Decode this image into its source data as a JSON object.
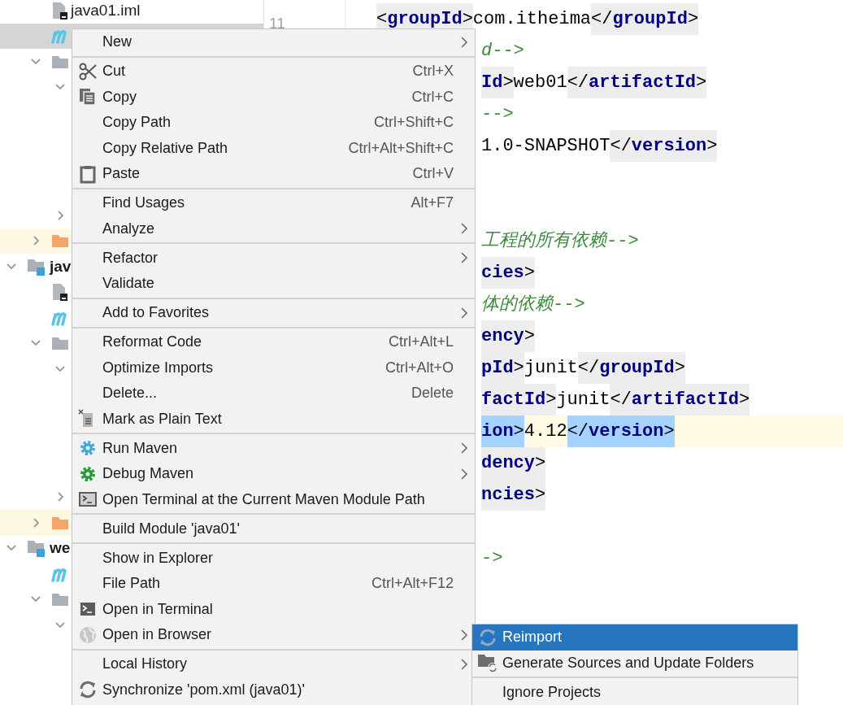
{
  "project_tree": {
    "items": [
      {
        "label": "java01.iml",
        "kind": "iml-file",
        "selected": false
      },
      {
        "kind": "maven-file",
        "selected": true
      },
      {
        "kind": "folder",
        "expanded": true,
        "selected": false,
        "children": [
          {
            "expanded": true,
            "selected": false
          },
          {
            "expanded": false,
            "selected": false
          }
        ]
      },
      {
        "kind": "excluded-folder",
        "expanded": false,
        "selected": false
      },
      {
        "label": "jav",
        "kind": "module",
        "expanded": true,
        "selected": false,
        "children": [
          {
            "kind": "iml-file",
            "selected": false
          },
          {
            "kind": "maven-file",
            "selected": false
          },
          {
            "kind": "folder",
            "expanded": true,
            "selected": false,
            "children": [
              {
                "expanded": true,
                "selected": false
              },
              {
                "expanded": false,
                "selected": false
              }
            ]
          },
          {
            "kind": "excluded-folder",
            "expanded": false,
            "selected": false
          }
        ]
      },
      {
        "label": "we",
        "kind": "module",
        "expanded": true,
        "selected": false,
        "children": [
          {
            "kind": "maven-file",
            "selected": false
          },
          {
            "kind": "folder",
            "expanded": true,
            "selected": false,
            "children": [
              {
                "expanded": true,
                "selected": false
              }
            ]
          }
        ]
      }
    ]
  },
  "gutter": {
    "line_number": "11"
  },
  "editor": {
    "lines": [
      {
        "kind": "full",
        "current": false,
        "groups": [
          {
            "kind": "match",
            "tokens": [
              {
                "kind": "p",
                "text": "<"
              },
              {
                "kind": "t",
                "text": "groupId"
              },
              {
                "kind": "p",
                "text": ">"
              }
            ]
          },
          {
            "kind": "plain",
            "tokens": [
              {
                "kind": "x",
                "text": "com.itheima"
              }
            ]
          },
          {
            "kind": "match",
            "tokens": [
              {
                "kind": "p",
                "text": "</"
              },
              {
                "kind": "t",
                "text": "groupId"
              },
              {
                "kind": "p",
                "text": ">"
              }
            ]
          }
        ]
      },
      {
        "kind": "clipped",
        "current": false,
        "groups": [
          {
            "kind": "plain",
            "tokens": [
              {
                "kind": "c",
                "text": "d-->"
              }
            ]
          }
        ]
      },
      {
        "kind": "clipped",
        "current": false,
        "groups": [
          {
            "kind": "match",
            "tokens": [
              {
                "kind": "t",
                "text": "Id"
              },
              {
                "kind": "p",
                "text": ">"
              }
            ]
          },
          {
            "kind": "plain",
            "tokens": [
              {
                "kind": "x",
                "text": "web01"
              }
            ]
          },
          {
            "kind": "match",
            "tokens": [
              {
                "kind": "p",
                "text": "</"
              },
              {
                "kind": "t",
                "text": "artifactId"
              },
              {
                "kind": "p",
                "text": ">"
              }
            ]
          }
        ]
      },
      {
        "kind": "clipped",
        "current": false,
        "groups": [
          {
            "kind": "plain",
            "tokens": [
              {
                "kind": "c",
                "text": "-->"
              }
            ]
          }
        ]
      },
      {
        "kind": "clipped",
        "current": false,
        "groups": [
          {
            "kind": "plain",
            "tokens": [
              {
                "kind": "x",
                "text": "1.0-SNAPSHOT"
              }
            ]
          },
          {
            "kind": "match",
            "tokens": [
              {
                "kind": "p",
                "text": "</"
              },
              {
                "kind": "t",
                "text": "version"
              },
              {
                "kind": "p",
                "text": ">"
              }
            ]
          }
        ]
      },
      {
        "kind": "blank"
      },
      {
        "kind": "blank"
      },
      {
        "kind": "clipped",
        "current": false,
        "groups": [
          {
            "kind": "plain",
            "tokens": [
              {
                "kind": "c",
                "text": "工程的所有依赖-->"
              }
            ]
          }
        ]
      },
      {
        "kind": "clipped",
        "current": false,
        "groups": [
          {
            "kind": "match",
            "tokens": [
              {
                "kind": "t",
                "text": "cies"
              },
              {
                "kind": "p",
                "text": ">"
              }
            ]
          }
        ]
      },
      {
        "kind": "clipped",
        "current": false,
        "groups": [
          {
            "kind": "plain",
            "tokens": [
              {
                "kind": "c",
                "text": "体的依赖-->"
              }
            ]
          }
        ]
      },
      {
        "kind": "clipped",
        "current": false,
        "groups": [
          {
            "kind": "match",
            "tokens": [
              {
                "kind": "t",
                "text": "ency"
              },
              {
                "kind": "p",
                "text": ">"
              }
            ]
          }
        ]
      },
      {
        "kind": "clipped",
        "current": false,
        "groups": [
          {
            "kind": "match",
            "tokens": [
              {
                "kind": "t",
                "text": "pId"
              },
              {
                "kind": "p",
                "text": ">"
              }
            ]
          },
          {
            "kind": "plain",
            "tokens": [
              {
                "kind": "x",
                "text": "junit"
              }
            ]
          },
          {
            "kind": "match",
            "tokens": [
              {
                "kind": "p",
                "text": "</"
              },
              {
                "kind": "t",
                "text": "groupId"
              },
              {
                "kind": "p",
                "text": ">"
              }
            ]
          }
        ]
      },
      {
        "kind": "clipped",
        "current": false,
        "groups": [
          {
            "kind": "match",
            "tokens": [
              {
                "kind": "t",
                "text": "factId"
              },
              {
                "kind": "p",
                "text": ">"
              }
            ]
          },
          {
            "kind": "plain",
            "tokens": [
              {
                "kind": "x",
                "text": "junit"
              }
            ]
          },
          {
            "kind": "match",
            "tokens": [
              {
                "kind": "p",
                "text": "</"
              },
              {
                "kind": "t",
                "text": "artifactId"
              },
              {
                "kind": "p",
                "text": ">"
              }
            ]
          }
        ]
      },
      {
        "kind": "clipped",
        "current": true,
        "groups": [
          {
            "kind": "selection",
            "tokens": [
              {
                "kind": "t",
                "text": "ion"
              },
              {
                "kind": "p",
                "text": ">"
              }
            ]
          },
          {
            "kind": "plain",
            "tokens": [
              {
                "kind": "x",
                "text": "4.12"
              }
            ]
          },
          {
            "kind": "selection",
            "tokens": [
              {
                "kind": "p",
                "text": "</"
              },
              {
                "kind": "t",
                "text": "version"
              },
              {
                "kind": "p",
                "text": ">"
              }
            ]
          }
        ]
      },
      {
        "kind": "clipped",
        "current": false,
        "groups": [
          {
            "kind": "match",
            "tokens": [
              {
                "kind": "t",
                "text": "dency"
              },
              {
                "kind": "p",
                "text": ">"
              }
            ]
          }
        ]
      },
      {
        "kind": "clipped",
        "current": false,
        "groups": [
          {
            "kind": "match",
            "tokens": [
              {
                "kind": "t",
                "text": "ncies"
              },
              {
                "kind": "p",
                "text": ">"
              }
            ]
          }
        ]
      },
      {
        "kind": "blank"
      },
      {
        "kind": "clipped",
        "current": false,
        "groups": [
          {
            "kind": "plain",
            "tokens": [
              {
                "kind": "c",
                "text": "->"
              }
            ]
          }
        ]
      }
    ]
  },
  "context_menu": {
    "groups": [
      [
        {
          "label": "New",
          "kind": "plain",
          "has_submenu": true
        }
      ],
      [
        {
          "label": "Cut",
          "shortcut": "Ctrl+X",
          "kind": "cut",
          "has_submenu": false
        },
        {
          "label": "Copy",
          "shortcut": "Ctrl+C",
          "kind": "copy",
          "has_submenu": false
        },
        {
          "label": "Copy Path",
          "shortcut": "Ctrl+Shift+C",
          "kind": "plain",
          "has_submenu": false
        },
        {
          "label": "Copy Relative Path",
          "shortcut": "Ctrl+Alt+Shift+C",
          "kind": "plain",
          "has_submenu": false
        },
        {
          "label": "Paste",
          "shortcut": "Ctrl+V",
          "kind": "paste",
          "has_submenu": false
        }
      ],
      [
        {
          "label": "Find Usages",
          "shortcut": "Alt+F7",
          "kind": "plain",
          "has_submenu": false
        },
        {
          "label": "Analyze",
          "kind": "plain",
          "has_submenu": true
        }
      ],
      [
        {
          "label": "Refactor",
          "kind": "plain",
          "has_submenu": true
        },
        {
          "label": "Validate",
          "kind": "plain",
          "has_submenu": false
        }
      ],
      [
        {
          "label": "Add to Favorites",
          "kind": "plain",
          "has_submenu": true
        }
      ],
      [
        {
          "label": "Reformat Code",
          "shortcut": "Ctrl+Alt+L",
          "kind": "plain",
          "has_submenu": false
        },
        {
          "label": "Optimize Imports",
          "shortcut": "Ctrl+Alt+O",
          "kind": "plain",
          "has_submenu": false
        },
        {
          "label": "Delete...",
          "shortcut": "Delete",
          "kind": "plain",
          "has_submenu": false
        },
        {
          "label": "Mark as Plain Text",
          "kind": "mark-plain",
          "has_submenu": false
        }
      ],
      [
        {
          "label": "Run Maven",
          "kind": "run",
          "has_submenu": true
        },
        {
          "label": "Debug Maven",
          "kind": "debug",
          "has_submenu": true
        },
        {
          "label": "Open Terminal at the Current Maven Module Path",
          "kind": "terminal-outline",
          "has_submenu": false
        }
      ],
      [
        {
          "label": "Build Module 'java01'",
          "kind": "plain",
          "has_submenu": false
        }
      ],
      [
        {
          "label": "Show in Explorer",
          "kind": "plain",
          "has_submenu": false
        },
        {
          "label": "File Path",
          "shortcut": "Ctrl+Alt+F12",
          "kind": "plain",
          "has_submenu": false
        },
        {
          "label": "Open in Terminal",
          "kind": "terminal",
          "has_submenu": false
        },
        {
          "label": "Open in Browser",
          "kind": "globe",
          "has_submenu": true
        }
      ],
      [
        {
          "label": "Local History",
          "kind": "plain",
          "has_submenu": true
        },
        {
          "label": "Synchronize 'pom.xml (java01)'",
          "kind": "sync",
          "has_submenu": false
        }
      ]
    ]
  },
  "submenu": {
    "groups": [
      [
        {
          "label": "Reimport",
          "kind": "sync",
          "selected": true
        },
        {
          "label": "Generate Sources and Update Folders",
          "kind": "folder-sync",
          "selected": false
        }
      ],
      [
        {
          "label": "Ignore Projects",
          "kind": "plain",
          "selected": false
        }
      ]
    ]
  }
}
